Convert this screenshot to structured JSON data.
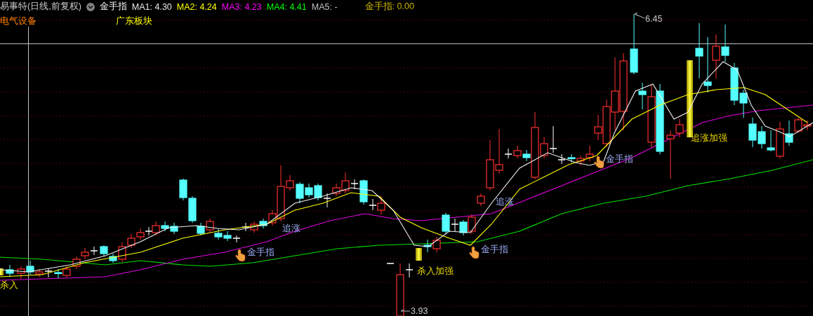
{
  "header": {
    "title": "易事特(日线,前复权)",
    "indicator": "金手指",
    "ma_readings": [
      {
        "text": "MA1: 4.30",
        "color": "#e8e8e8"
      },
      {
        "text": "MA2: 4.24",
        "color": "#ffff00"
      },
      {
        "text": "MA3: 4.23",
        "color": "#ff00ff"
      },
      {
        "text": "MA4: 4.41",
        "color": "#00ff00"
      },
      {
        "text": "MA5: -",
        "color": "#c0c0c0"
      }
    ],
    "indicator_reading": "金手指: 0.00"
  },
  "sectors": [
    {
      "text": "电气设备",
      "color": "#ff8000"
    },
    {
      "text": "广东板块",
      "color": "#ffff00"
    }
  ],
  "chart": {
    "high_label": "6.45",
    "low_label": "3.93",
    "signals": [
      {
        "kind": "kill",
        "text": "杀入"
      },
      {
        "kind": "finger",
        "text": "金手指"
      },
      {
        "kind": "chase",
        "text": "追涨"
      },
      {
        "kind": "kill",
        "text": "杀入加强"
      },
      {
        "kind": "finger",
        "text": "金手指"
      },
      {
        "kind": "chase",
        "text": "追涨"
      },
      {
        "kind": "finger",
        "text": "金手指"
      },
      {
        "kind": "kill",
        "text": "追涨加强"
      }
    ]
  }
}
